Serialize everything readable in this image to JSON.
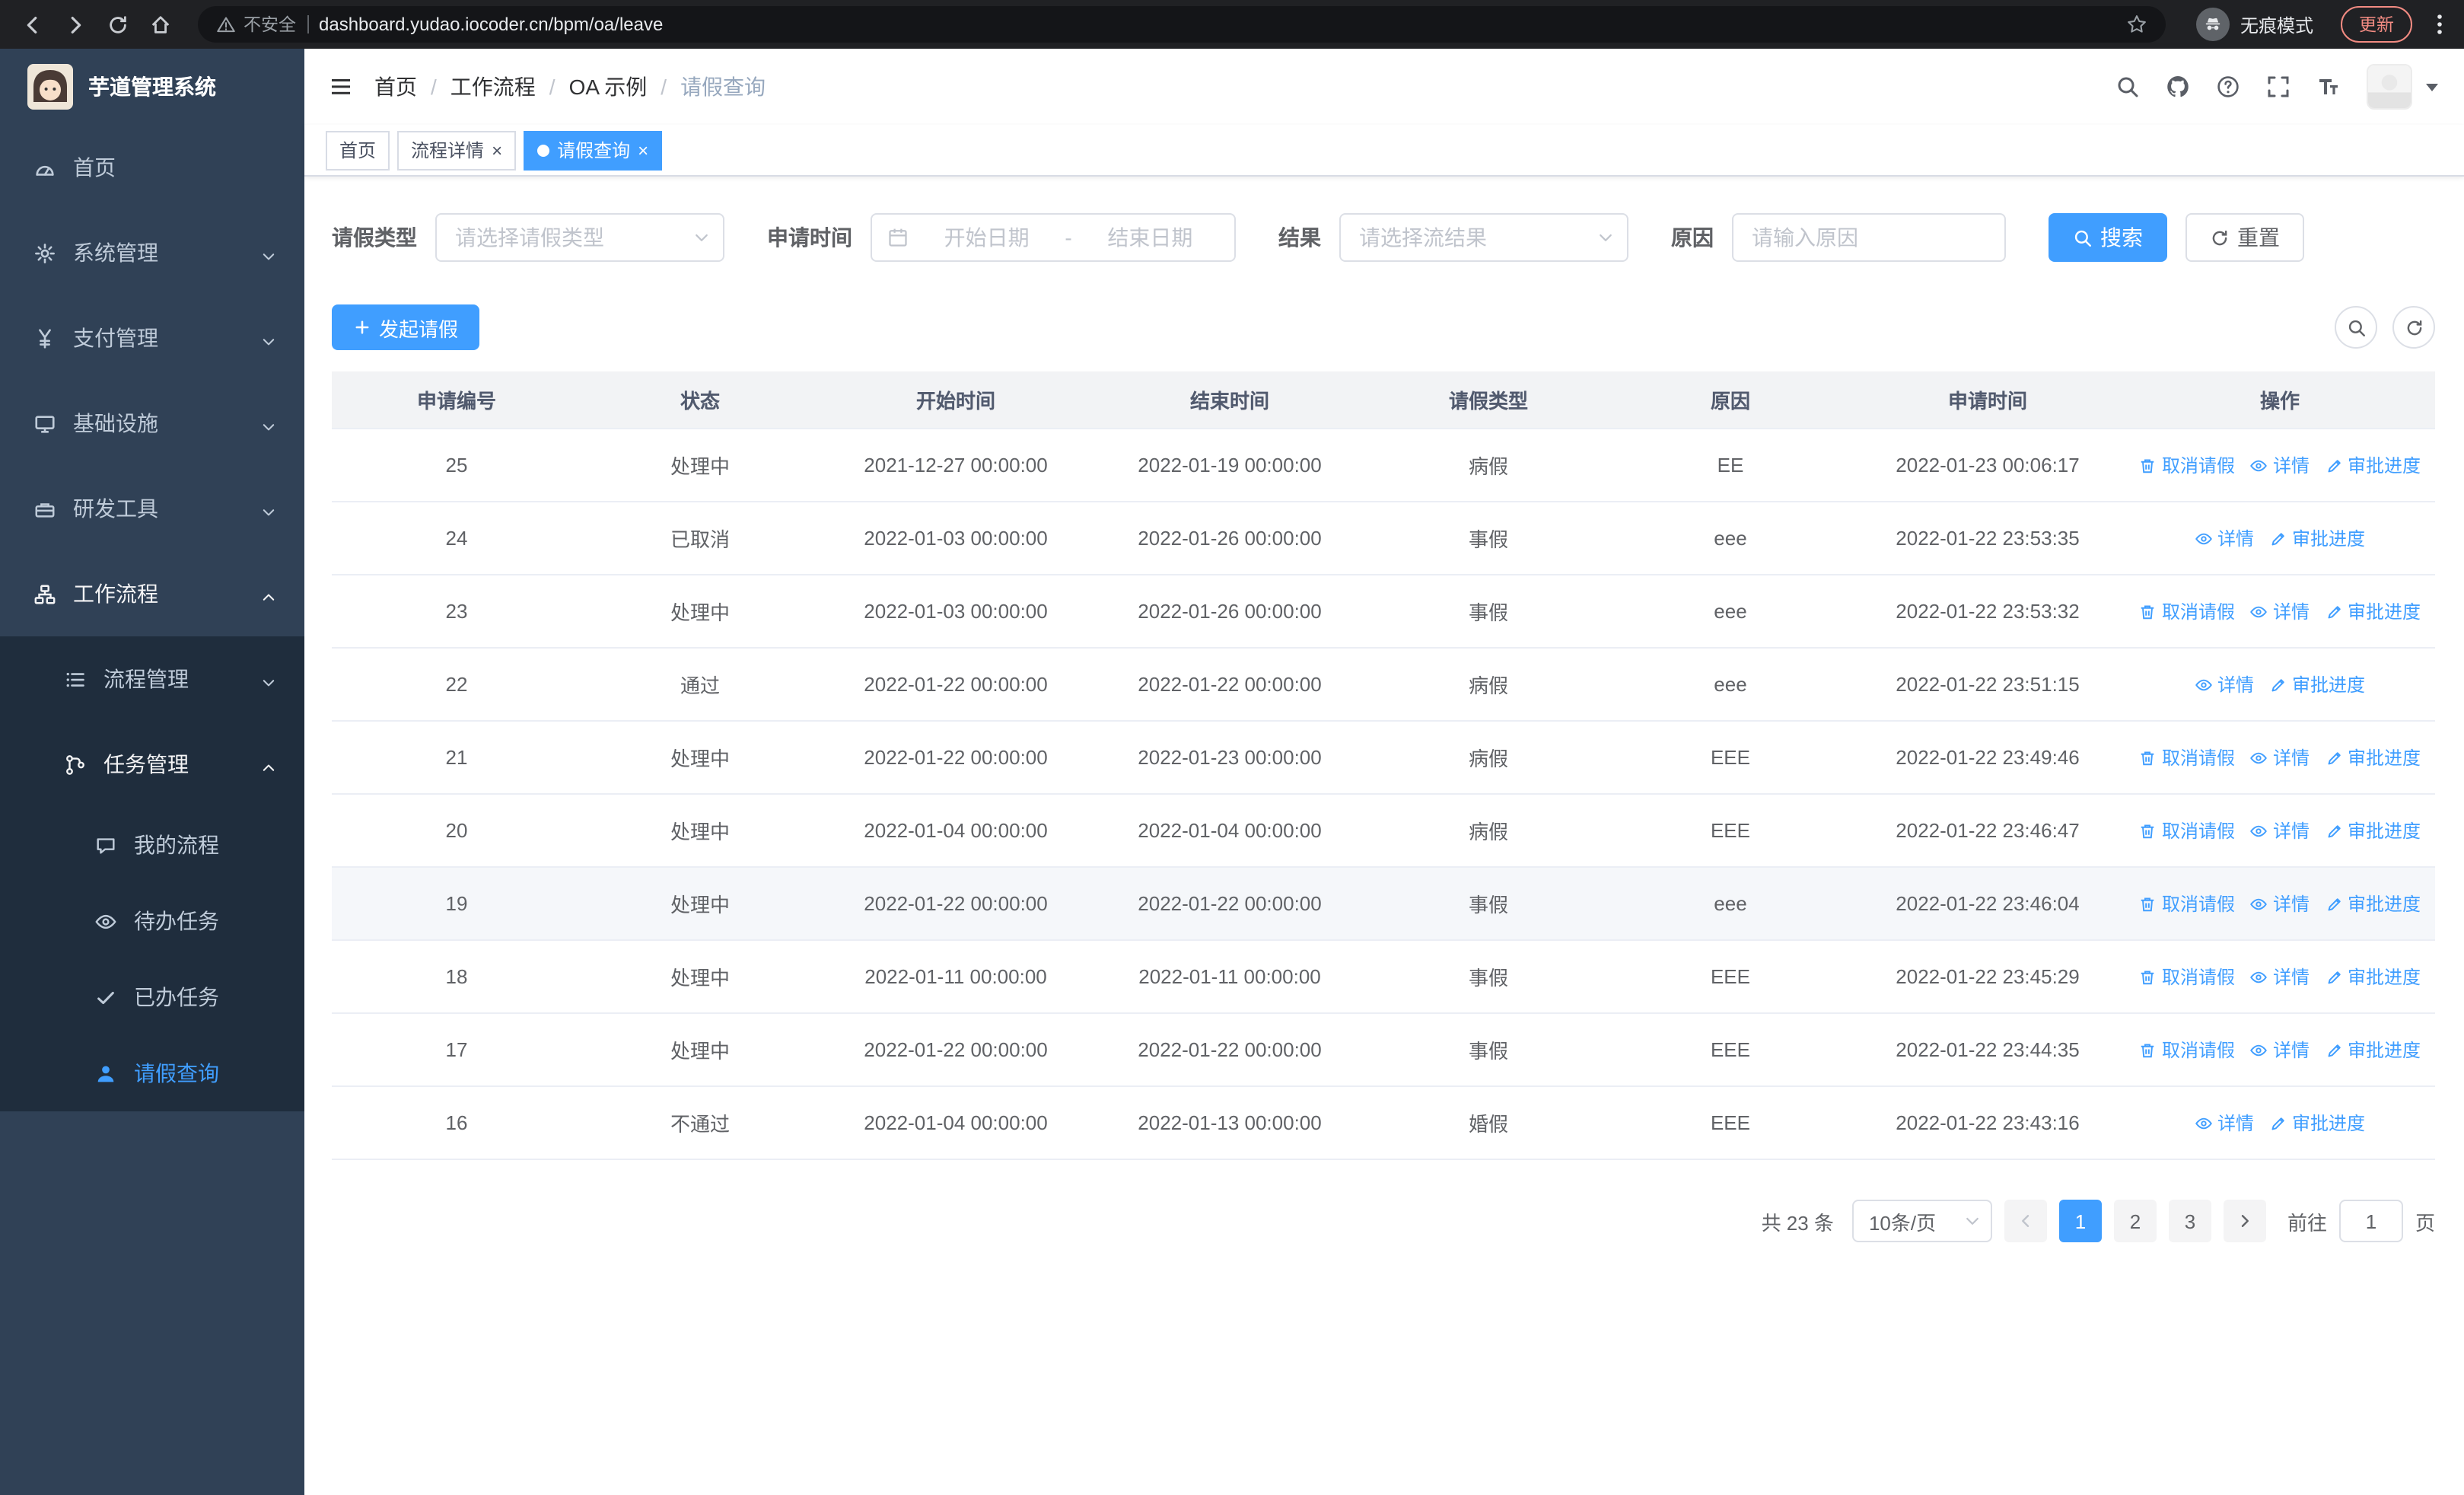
{
  "browser": {
    "security_label": "不安全",
    "url": "dashboard.yudao.iocoder.cn/bpm/oa/leave",
    "incognito_label": "无痕模式",
    "update_label": "更新"
  },
  "sidebar": {
    "app_title": "芋道管理系统",
    "menu": [
      {
        "key": "home",
        "label": "首页",
        "icon": "dashboard",
        "level": 1
      },
      {
        "key": "system-management",
        "label": "系统管理",
        "icon": "gear",
        "level": 1,
        "chevron": "down"
      },
      {
        "key": "payment-management",
        "label": "支付管理",
        "icon": "yen",
        "level": 1,
        "chevron": "down"
      },
      {
        "key": "infrastructure",
        "label": "基础设施",
        "icon": "monitor",
        "level": 1,
        "chevron": "down"
      },
      {
        "key": "dev-tools",
        "label": "研发工具",
        "icon": "toolbox",
        "level": 1,
        "chevron": "down"
      },
      {
        "key": "workflow",
        "label": "工作流程",
        "icon": "workflow",
        "level": 1,
        "chevron": "up"
      },
      {
        "key": "process-management",
        "label": "流程管理",
        "icon": "list",
        "level": 2,
        "sub": true,
        "chevron": "down"
      },
      {
        "key": "task-management",
        "label": "任务管理",
        "icon": "branch",
        "level": 2,
        "sub": true,
        "chevron": "up"
      },
      {
        "key": "my-processes",
        "label": "我的流程",
        "icon": "chat",
        "level": 3,
        "sub": true
      },
      {
        "key": "todo-tasks",
        "label": "待办任务",
        "icon": "eye",
        "level": 3,
        "sub": true
      },
      {
        "key": "done-tasks",
        "label": "已办任务",
        "icon": "check",
        "level": 3,
        "sub": true
      },
      {
        "key": "leave-query",
        "label": "请假查询",
        "icon": "user",
        "level": 3,
        "sub": true,
        "active": true
      }
    ]
  },
  "header": {
    "breadcrumb": [
      {
        "key": "home",
        "label": "首页"
      },
      {
        "key": "workflow",
        "label": "工作流程"
      },
      {
        "key": "oa-example",
        "label": "OA 示例"
      },
      {
        "key": "leave-query",
        "label": "请假查询",
        "current": true
      }
    ]
  },
  "tabs": [
    {
      "key": "home",
      "label": "首页",
      "closable": false,
      "active": false
    },
    {
      "key": "process-detail",
      "label": "流程详情",
      "closable": true,
      "active": false
    },
    {
      "key": "leave-query",
      "label": "请假查询",
      "closable": true,
      "active": true
    }
  ],
  "filters": {
    "leave_type": {
      "label": "请假类型",
      "placeholder": "请选择请假类型"
    },
    "apply_time": {
      "label": "申请时间",
      "start_placeholder": "开始日期",
      "separator": "-",
      "end_placeholder": "结束日期"
    },
    "result": {
      "label": "结果",
      "placeholder": "请选择流结果"
    },
    "reason": {
      "label": "原因",
      "placeholder": "请输入原因"
    },
    "search_label": "搜索",
    "reset_label": "重置"
  },
  "toolbar": {
    "create_label": "发起请假"
  },
  "table": {
    "columns": [
      "申请编号",
      "状态",
      "开始时间",
      "结束时间",
      "请假类型",
      "原因",
      "申请时间",
      "操作"
    ],
    "action_labels": {
      "cancel": "取消请假",
      "detail": "详情",
      "progress": "审批进度"
    },
    "rows": [
      {
        "id": "25",
        "status": "处理中",
        "start": "2021-12-27 00:00:00",
        "end": "2022-01-19 00:00:00",
        "type": "病假",
        "reason": "EE",
        "applied": "2022-01-23 00:06:17",
        "actions": [
          "cancel",
          "detail",
          "progress"
        ]
      },
      {
        "id": "24",
        "status": "已取消",
        "start": "2022-01-03 00:00:00",
        "end": "2022-01-26 00:00:00",
        "type": "事假",
        "reason": "eee",
        "applied": "2022-01-22 23:53:35",
        "actions": [
          "detail",
          "progress"
        ]
      },
      {
        "id": "23",
        "status": "处理中",
        "start": "2022-01-03 00:00:00",
        "end": "2022-01-26 00:00:00",
        "type": "事假",
        "reason": "eee",
        "applied": "2022-01-22 23:53:32",
        "actions": [
          "cancel",
          "detail",
          "progress"
        ]
      },
      {
        "id": "22",
        "status": "通过",
        "start": "2022-01-22 00:00:00",
        "end": "2022-01-22 00:00:00",
        "type": "病假",
        "reason": "eee",
        "applied": "2022-01-22 23:51:15",
        "actions": [
          "detail",
          "progress"
        ]
      },
      {
        "id": "21",
        "status": "处理中",
        "start": "2022-01-22 00:00:00",
        "end": "2022-01-23 00:00:00",
        "type": "病假",
        "reason": "EEE",
        "applied": "2022-01-22 23:49:46",
        "actions": [
          "cancel",
          "detail",
          "progress"
        ]
      },
      {
        "id": "20",
        "status": "处理中",
        "start": "2022-01-04 00:00:00",
        "end": "2022-01-04 00:00:00",
        "type": "病假",
        "reason": "EEE",
        "applied": "2022-01-22 23:46:47",
        "actions": [
          "cancel",
          "detail",
          "progress"
        ]
      },
      {
        "id": "19",
        "status": "处理中",
        "start": "2022-01-22 00:00:00",
        "end": "2022-01-22 00:00:00",
        "type": "事假",
        "reason": "eee",
        "applied": "2022-01-22 23:46:04",
        "actions": [
          "cancel",
          "detail",
          "progress"
        ],
        "highlighted": true
      },
      {
        "id": "18",
        "status": "处理中",
        "start": "2022-01-11 00:00:00",
        "end": "2022-01-11 00:00:00",
        "type": "事假",
        "reason": "EEE",
        "applied": "2022-01-22 23:45:29",
        "actions": [
          "cancel",
          "detail",
          "progress"
        ]
      },
      {
        "id": "17",
        "status": "处理中",
        "start": "2022-01-22 00:00:00",
        "end": "2022-01-22 00:00:00",
        "type": "事假",
        "reason": "EEE",
        "applied": "2022-01-22 23:44:35",
        "actions": [
          "cancel",
          "detail",
          "progress"
        ]
      },
      {
        "id": "16",
        "status": "不通过",
        "start": "2022-01-04 00:00:00",
        "end": "2022-01-13 00:00:00",
        "type": "婚假",
        "reason": "EEE",
        "applied": "2022-01-22 23:43:16",
        "actions": [
          "detail",
          "progress"
        ]
      }
    ]
  },
  "pagination": {
    "total_label": "共 23 条",
    "page_size": "10条/页",
    "pages": [
      "1",
      "2",
      "3"
    ],
    "current_page": "1",
    "goto_label": "前往",
    "goto_value": "1",
    "page_unit": "页"
  },
  "colors": {
    "primary": "#409eff",
    "sidebar_bg": "#304156",
    "submenu_bg": "#1f2d3d"
  }
}
